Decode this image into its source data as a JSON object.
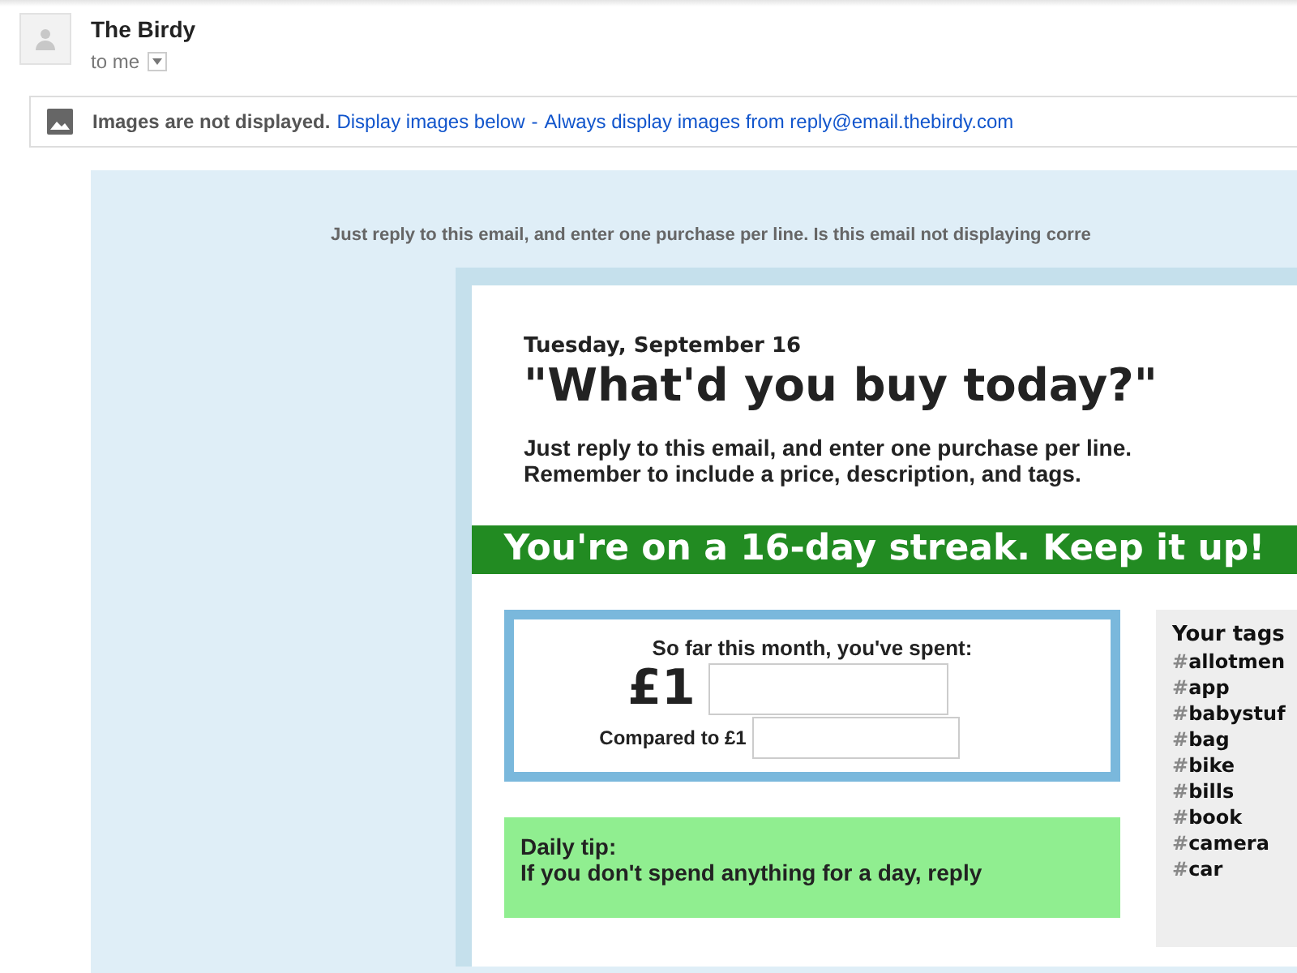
{
  "sender": {
    "name": "The Birdy",
    "recipient": "to me"
  },
  "images_notice": {
    "message": "Images are not displayed.",
    "link_1": "Display images below",
    "separator": "-",
    "link_2": "Always display images from reply@email.thebirdy.com"
  },
  "email": {
    "preheader": "Just reply to this email, and enter one purchase per line. Is this email not displaying corre",
    "date": "Tuesday, September 16",
    "heading": "\"What'd you buy today?\"",
    "instructions": [
      "Just reply to this email, and enter one purchase per line.",
      "Remember to include a price, description, and tags."
    ],
    "streak": "You're on a 16-day streak. Keep it up!",
    "spent": {
      "label": "So far this month, you've spent:",
      "amount": "£1",
      "comparison": "Compared to £1"
    },
    "tip": {
      "title": "Daily tip:",
      "text": "If you don't spend anything for a day, reply"
    },
    "tags": {
      "title": "Your tags",
      "items": [
        {
          "hash": "#",
          "tag": "allotmen"
        },
        {
          "hash": "#",
          "tag": "app"
        },
        {
          "hash": "#",
          "tag": "babystuf"
        },
        {
          "hash": "#",
          "tag": "bag"
        },
        {
          "hash": "#",
          "tag": "bike"
        },
        {
          "hash": "#",
          "tag": "bills"
        },
        {
          "hash": "#",
          "tag": "book"
        },
        {
          "hash": "#",
          "tag": "camera"
        },
        {
          "hash": "#",
          "tag": "car"
        }
      ]
    }
  }
}
